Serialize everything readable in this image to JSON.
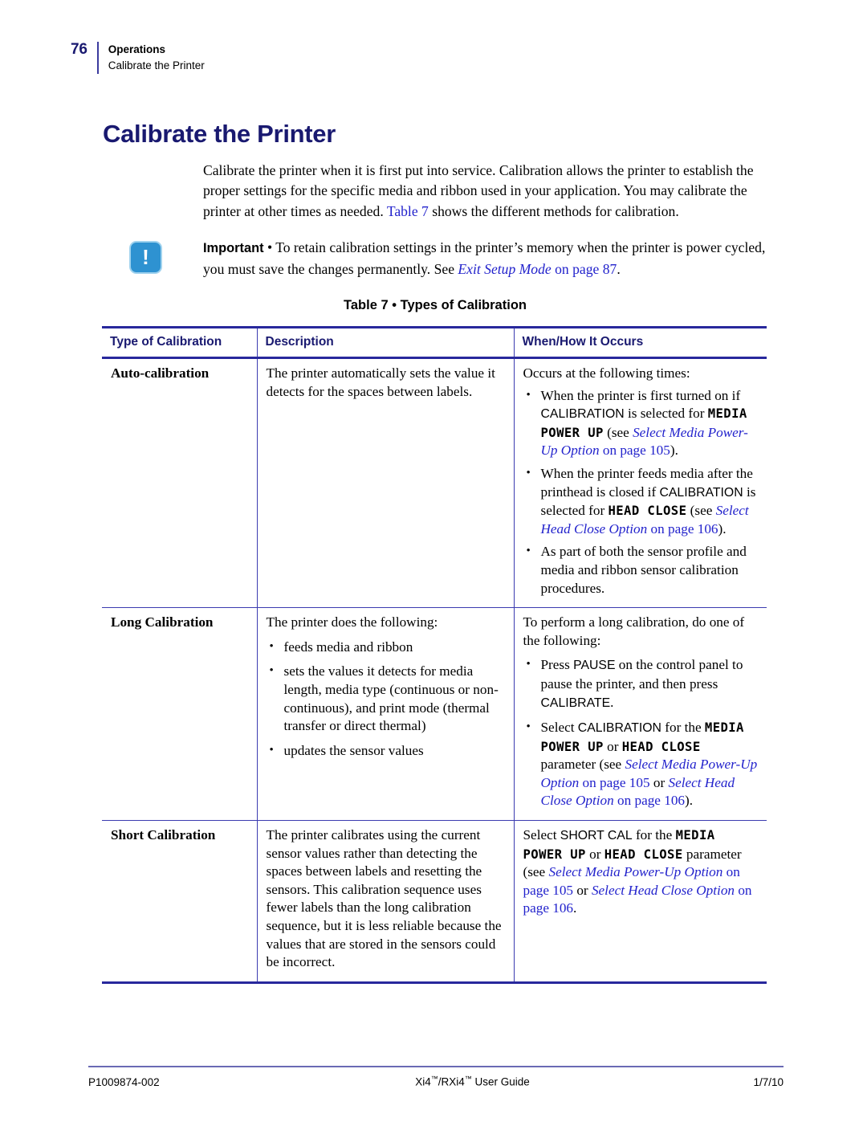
{
  "running_header": {
    "page_number": "76",
    "chapter": "Operations",
    "section": "Calibrate the Printer"
  },
  "page_title": "Calibrate the Printer",
  "intro": {
    "part1": "Calibrate the printer when it is first put into service. Calibration allows the printer to establish the proper settings for the specific media and ribbon used in your application. You may calibrate the printer at other times as needed. ",
    "link": "Table 7",
    "part2": " shows the different methods for calibration."
  },
  "note": {
    "icon": "important-exclamation-icon",
    "label": "Important",
    "separator": " • ",
    "text1": "To retain calibration settings in the printer’s memory when the printer is power cycled, you must save the changes permanently. See ",
    "link": "Exit Setup Mode",
    "text2": " on page 87",
    "text3": "."
  },
  "table": {
    "caption": "Table 7 • Types of Calibration",
    "headers": [
      "Type of Calibration",
      "Description",
      "When/How It Occurs"
    ],
    "rows": [
      {
        "type": "Auto-calibration",
        "description": {
          "intro": "The printer automatically sets the value it detects for the spaces between labels."
        },
        "occurs": {
          "intro": "Occurs at the following times:",
          "bullets": [
            {
              "t1": "When the printer is first turned on if ",
              "caps1": "CALIBRATION",
              "t2": " is selected for ",
              "lcd1": "MEDIA POWER UP",
              "t3": " (see ",
              "link1": "Select Media Power-Up Option",
              "t4": " ",
              "link2": "on page 105",
              "t5": ")."
            },
            {
              "t1": "When the printer feeds media after the printhead is closed if ",
              "caps1": "CALIBRATION",
              "t2": " is selected for ",
              "lcd1": "HEAD CLOSE",
              "t3": " (see ",
              "link1": "Select Head Close Option",
              "t4": " ",
              "link2": "on page 106",
              "t5": ")."
            },
            {
              "t1": "As part of both the sensor profile and media and ribbon sensor calibration procedures.",
              "caps1": "",
              "t2": "",
              "lcd1": "",
              "t3": "",
              "link1": "",
              "t4": "",
              "link2": "",
              "t5": ""
            }
          ]
        }
      },
      {
        "type": "Long Calibration",
        "description": {
          "intro": "The printer does the following:",
          "bullets": [
            "feeds media and ribbon",
            "sets the values it detects for media length, media type (continuous or non-continuous), and print mode (thermal transfer or direct thermal)",
            "updates the sensor values"
          ]
        },
        "occurs": {
          "intro": "To perform a long calibration, do one of the following:",
          "bullets": [
            {
              "t1": "Press ",
              "caps1": "PAUSE",
              "t2": " on the control panel to pause the printer, and then press ",
              "caps2": "CALIBRATE",
              "t3": "."
            },
            {
              "t1": "Select ",
              "caps1": "CALIBRATION",
              "t2": " for the ",
              "lcd1": "MEDIA POWER UP",
              "t3": " or ",
              "lcd2": "HEAD CLOSE",
              "t4": " parameter (see ",
              "link1": "Select Media Power-Up Option",
              "t5": " ",
              "link2": "on page 105",
              "t6": " or ",
              "link3": "Select Head Close Option",
              "t7": " ",
              "link4": "on page 106",
              "t8": ")."
            }
          ]
        }
      },
      {
        "type": "Short Calibration",
        "description": {
          "intro": "The printer calibrates using the current sensor values rather than detecting the spaces between labels and resetting the sensors. This calibration sequence uses fewer labels than the long calibration sequence, but it is less reliable because the values that are stored in the sensors could be incorrect."
        },
        "occurs": {
          "t1": "Select ",
          "caps1": "SHORT CAL",
          "t2": " for the ",
          "lcd1": "MEDIA POWER UP",
          "t3": " or ",
          "lcd2": "HEAD CLOSE",
          "t4": " parameter (see ",
          "link1": "Select Media Power-Up Option",
          "t5": " ",
          "link2": "on page 105",
          "t6": " or ",
          "link3": "Select Head Close",
          "t7": " ",
          "link4": "Option",
          "t8": " ",
          "link5": "on page 106",
          "t9": "."
        }
      }
    ]
  },
  "footer": {
    "part_number": "P1009874-002",
    "guide_title_a": "Xi4",
    "guide_title_b": "/RXi4",
    "guide_title_c": " User Guide",
    "trademark": "™",
    "date": "1/7/10"
  },
  "colors": {
    "heading_blue": "#191970",
    "link_blue": "#2222cc",
    "table_rule": "#28289c",
    "note_icon": "#2e92d1"
  }
}
